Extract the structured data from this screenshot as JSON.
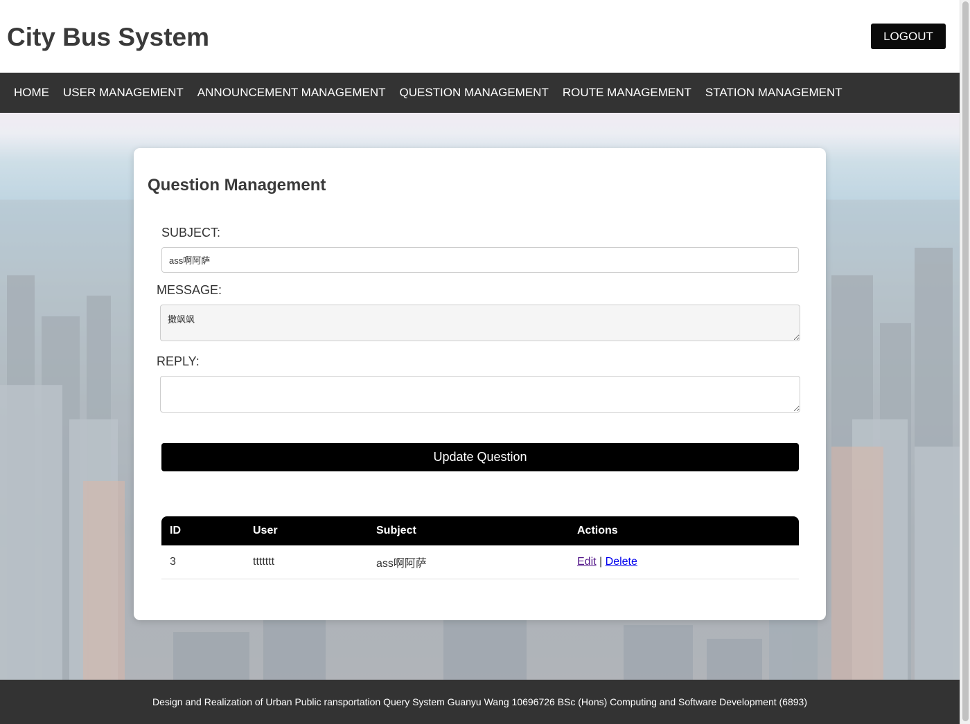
{
  "header": {
    "title": "City Bus System",
    "logout_label": "LOGOUT"
  },
  "nav": {
    "items": [
      {
        "label": "HOME"
      },
      {
        "label": "USER MANAGEMENT"
      },
      {
        "label": "ANNOUNCEMENT MANAGEMENT"
      },
      {
        "label": "QUESTION MANAGEMENT"
      },
      {
        "label": "ROUTE MANAGEMENT"
      },
      {
        "label": "STATION MANAGEMENT"
      }
    ]
  },
  "form": {
    "heading": "Question Management",
    "subject_label": "SUBJECT:",
    "subject_value": "ass啊阿萨",
    "message_label": "MESSAGE:",
    "message_value": "撒飒飒",
    "reply_label": "REPLY:",
    "reply_value": "",
    "submit_label": "Update Question"
  },
  "table": {
    "columns": [
      "ID",
      "User",
      "Subject",
      "Actions"
    ],
    "rows": [
      {
        "id": "3",
        "user": "ttttttt",
        "subject": "ass啊阿萨",
        "edit_label": "Edit",
        "separator": "|",
        "delete_label": "Delete"
      }
    ]
  },
  "footer": {
    "text": "Design and Realization of Urban Public ransportation Query System Guanyu Wang 10696726 BSc (Hons) Computing and Software Development (6893)"
  },
  "colors": {
    "nav_bg": "#333333",
    "button_bg": "#000000",
    "footer_bg": "#333333",
    "link_visited": "#551a8b",
    "link": "#0000ee"
  }
}
